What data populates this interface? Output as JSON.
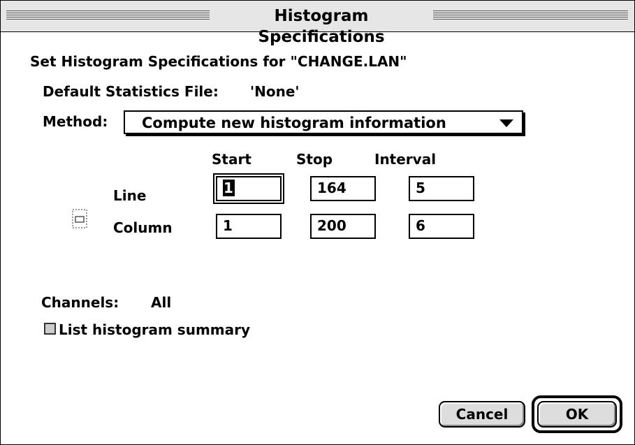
{
  "window": {
    "title": "Histogram Specifications"
  },
  "dialog": {
    "heading": "Set Histogram Specifications for \"CHANGE.LAN\"",
    "stats_file_label": "Default Statistics File:",
    "stats_file_value": "'None'",
    "method_label": "Method:",
    "method_value": "Compute new histogram information",
    "columns": {
      "start": "Start",
      "stop": "Stop",
      "interval": "Interval"
    },
    "rows": {
      "line": {
        "label": "Line",
        "start": "1",
        "stop": "164",
        "interval": "5"
      },
      "column": {
        "label": "Column",
        "start": "1",
        "stop": "200",
        "interval": "6"
      }
    },
    "channels_label": "Channels:",
    "channels_value": "All",
    "checkbox_label": "List histogram summary",
    "checkbox_checked": false,
    "link_icon": "link-area-icon"
  },
  "buttons": {
    "cancel": "Cancel",
    "ok": "OK"
  },
  "colors": {
    "titlebar": "#e6e6e6",
    "selection": "#000000",
    "button_face": "#dddddd"
  }
}
